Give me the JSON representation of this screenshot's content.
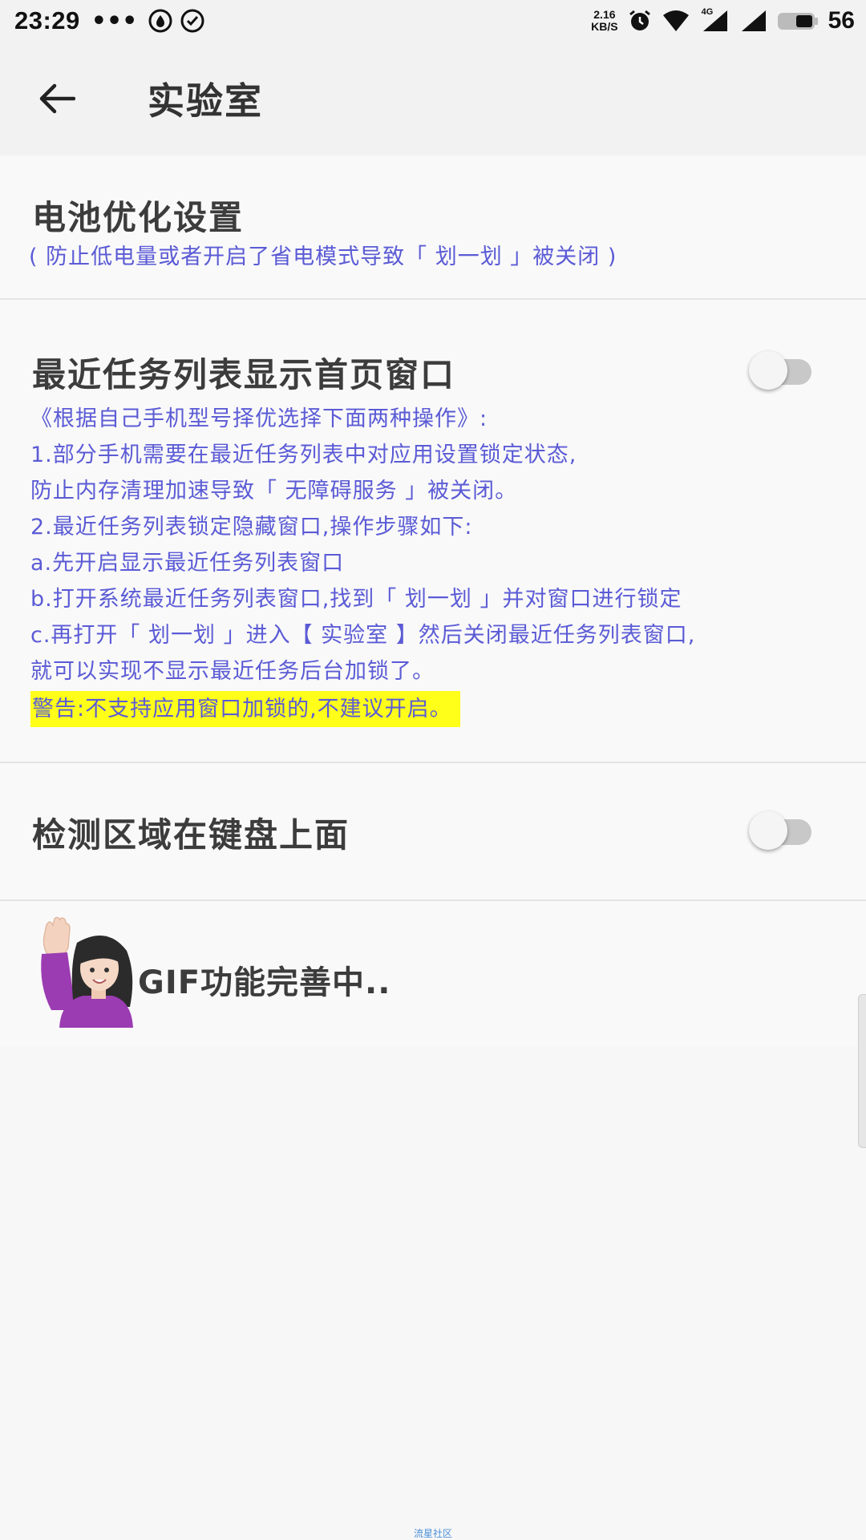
{
  "status_bar": {
    "time": "23:29",
    "dots": "•••",
    "net_speed_value": "2.16",
    "net_speed_unit": "KB/S",
    "network_type": "4G",
    "battery_level": "56"
  },
  "app_bar": {
    "title": "实验室",
    "back_icon": "arrow-left-icon"
  },
  "sections": {
    "battery": {
      "title": "电池优化设置",
      "subtitle": "( 防止低电量或者开启了省电模式导致「 划一划 」被关闭 )"
    },
    "recent": {
      "title": "最近任务列表显示首页窗口",
      "toggle_on": false,
      "lines": [
        "《根据自己手机型号择优选择下面两种操作》:",
        "1.部分手机需要在最近任务列表中对应用设置锁定状态,",
        "防止内存清理加速导致「 无障碍服务 」被关闭。",
        "2.最近任务列表锁定隐藏窗口,操作步骤如下:",
        "a.先开启显示最近任务列表窗口",
        "b.打开系统最近任务列表窗口,找到「 划一划 」并对窗口进行锁定",
        "c.再打开「 划一划 」进入【 实验室 】然后关闭最近任务列表窗口,",
        "就可以实现不显示最近任务后台加锁了。"
      ],
      "warning": "警告:不支持应用窗口加锁的,不建议开启。"
    },
    "keyboard": {
      "title": "检测区域在键盘上面",
      "toggle_on": false
    },
    "gif": {
      "text": "GIF功能完善中..",
      "avatar_icon": "woman-raising-hand-icon"
    }
  },
  "watermark": "流星社区",
  "colors": {
    "accent_text": "#5b5bd6",
    "warning_bg": "#ffff1a",
    "title_text": "#3c3c3c"
  }
}
